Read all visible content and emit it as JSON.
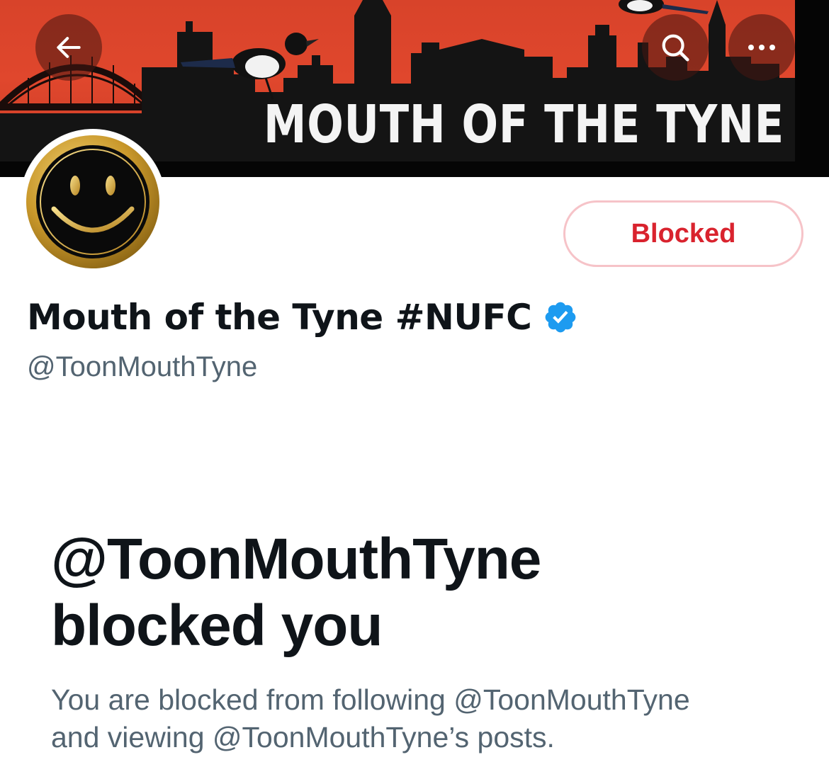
{
  "header": {
    "banner_text": "MOUTH OF THE TYNE",
    "banner_color": "#d8432a",
    "back_icon": "arrow-left-icon",
    "search_icon": "search-icon",
    "more_icon": "more-horizontal-icon"
  },
  "profile": {
    "avatar_icon": "smiley-face-avatar",
    "display_name": "Mouth of the Tyne #NUFC",
    "verified_icon": "verified-badge-icon",
    "verified_color": "#1d9bf0",
    "handle": "@ToonMouthTyne",
    "blocked_button_label": "Blocked",
    "blocked_color": "#d9232e"
  },
  "blocked_notice": {
    "heading_line1": "@ToonMouthTyne",
    "heading_line2": "blocked you",
    "description_line1": "You are blocked from following @ToonMouthTyne",
    "description_line2": "and viewing @ToonMouthTyne’s posts."
  }
}
